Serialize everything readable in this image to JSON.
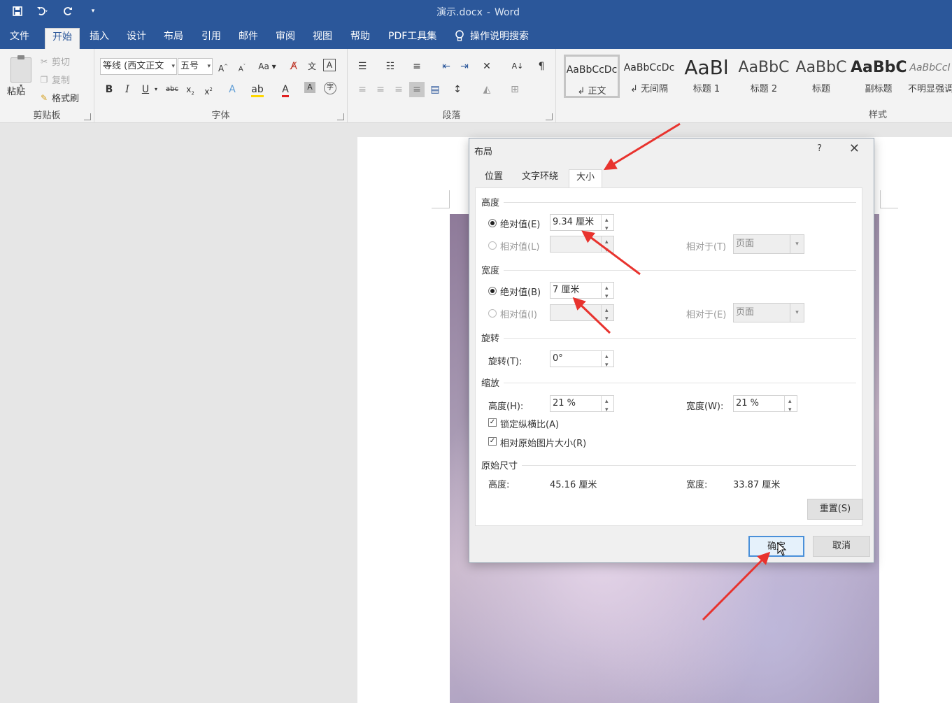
{
  "window": {
    "doc_name": "演示.docx",
    "separator": "-",
    "app_name": "Word"
  },
  "qat": {
    "save_icon": "save-icon",
    "undo_icon": "undo-icon",
    "redo_icon": "redo-icon",
    "customize_icon": "customize-qat-icon"
  },
  "tabs": [
    "文件",
    "开始",
    "插入",
    "设计",
    "布局",
    "引用",
    "邮件",
    "审阅",
    "视图",
    "帮助",
    "PDF工具集"
  ],
  "tell_me": "操作说明搜索",
  "clipboard": {
    "paste": "粘贴",
    "cut": "剪切",
    "copy": "复制",
    "format_painter": "格式刷",
    "group_label": "剪贴板"
  },
  "font": {
    "family": "等线 (西文正文",
    "size": "五号",
    "group_label": "字体"
  },
  "paragraph": {
    "group_label": "段落"
  },
  "styles": {
    "group_label": "样式",
    "items": [
      {
        "sample": "AaBbCcDc",
        "name": "↲ 正文"
      },
      {
        "sample": "AaBbCcDc",
        "name": "↲ 无间隔"
      },
      {
        "sample": "AaBl",
        "name": "标题 1"
      },
      {
        "sample": "AaBbC",
        "name": "标题 2"
      },
      {
        "sample": "AaBbC",
        "name": "标题"
      },
      {
        "sample": "AaBbC",
        "name": "副标题"
      },
      {
        "sample": "AaBbCcI",
        "name": "不明显强调"
      }
    ]
  },
  "dialog": {
    "title": "布局",
    "help": "?",
    "close": "✕",
    "tabs": [
      "位置",
      "文字环绕",
      "大小"
    ],
    "height_section": "高度",
    "height_abs_label": "绝对值(E)",
    "height_abs_value": "9.34 厘米",
    "height_rel_label": "相对值(L)",
    "height_rel_to_label": "相对于(T)",
    "height_rel_to_value": "页面",
    "width_section": "宽度",
    "width_abs_label": "绝对值(B)",
    "width_abs_value": "7 厘米",
    "width_rel_label": "相对值(I)",
    "width_rel_to_label": "相对于(E)",
    "width_rel_to_value": "页面",
    "rotate_section": "旋转",
    "rotate_label": "旋转(T):",
    "rotate_value": "0°",
    "scale_section": "缩放",
    "scale_height_label": "高度(H):",
    "scale_height_value": "21 %",
    "scale_width_label": "宽度(W):",
    "scale_width_value": "21 %",
    "lock_aspect_label": "锁定纵横比(A)",
    "relative_original_label": "相对原始图片大小(R)",
    "original_section": "原始尺寸",
    "orig_height_label": "高度:",
    "orig_height_value": "45.16 厘米",
    "orig_width_label": "宽度:",
    "orig_width_value": "33.87 厘米",
    "reset_button": "重置(S)",
    "ok_button": "确定",
    "cancel_button": "取消"
  },
  "colors": {
    "brand": "#2b579a",
    "arrow": "#e8332e"
  }
}
